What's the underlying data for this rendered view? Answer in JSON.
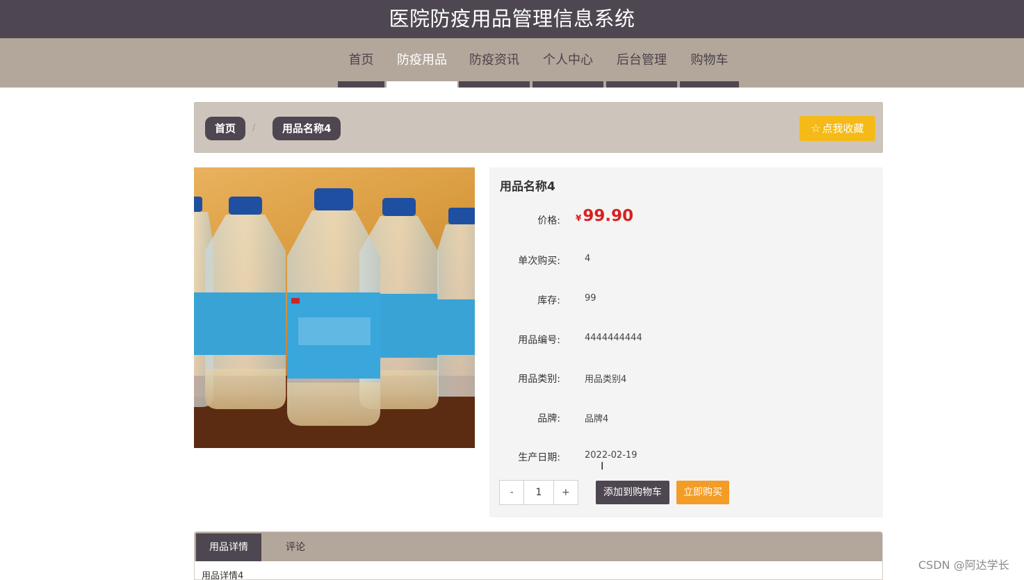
{
  "header": {
    "site_title": "医院防疫用品管理信息系统"
  },
  "nav": {
    "items": [
      {
        "label": "首页",
        "active": false
      },
      {
        "label": "防疫用品",
        "active": true
      },
      {
        "label": "防疫资讯",
        "active": false
      },
      {
        "label": "个人中心",
        "active": false
      },
      {
        "label": "后台管理",
        "active": false
      },
      {
        "label": "购物车",
        "active": false
      }
    ]
  },
  "breadcrumb": {
    "home": "首页",
    "separator": "/",
    "current": "用品名称4"
  },
  "favorite_button": {
    "icon": "star-outline-icon",
    "label": "点我收藏"
  },
  "product": {
    "image_icon": "alcohol-bottles-photo",
    "name": "用品名称4",
    "price_label": "价格:",
    "currency": "¥",
    "price": "99.90",
    "fields": [
      {
        "label": "单次购买:",
        "value": "4"
      },
      {
        "label": "库存:",
        "value": "99"
      },
      {
        "label": "用品编号:",
        "value": "4444444444"
      },
      {
        "label": "用品类别:",
        "value": "用品类别4"
      },
      {
        "label": "品牌:",
        "value": "品牌4"
      },
      {
        "label": "生产日期:",
        "value": "2022-02-19"
      }
    ]
  },
  "quantity": {
    "minus": "-",
    "value": "1",
    "plus": "+"
  },
  "actions": {
    "add_to_cart": "添加到购物车",
    "buy_now": "立即购买"
  },
  "tabs": {
    "items": [
      {
        "label": "用品详情",
        "active": true
      },
      {
        "label": "评论",
        "active": false
      }
    ],
    "content": "用品详情4"
  },
  "watermark": "CSDN @阿达学长",
  "colors": {
    "header_bg": "#4e4650",
    "nav_bg": "#b3a69b",
    "breadcrumb_bg": "#cdc5bb",
    "favorite": "#f5ba17",
    "price": "#d9201f",
    "buy_now": "#f39c26"
  }
}
